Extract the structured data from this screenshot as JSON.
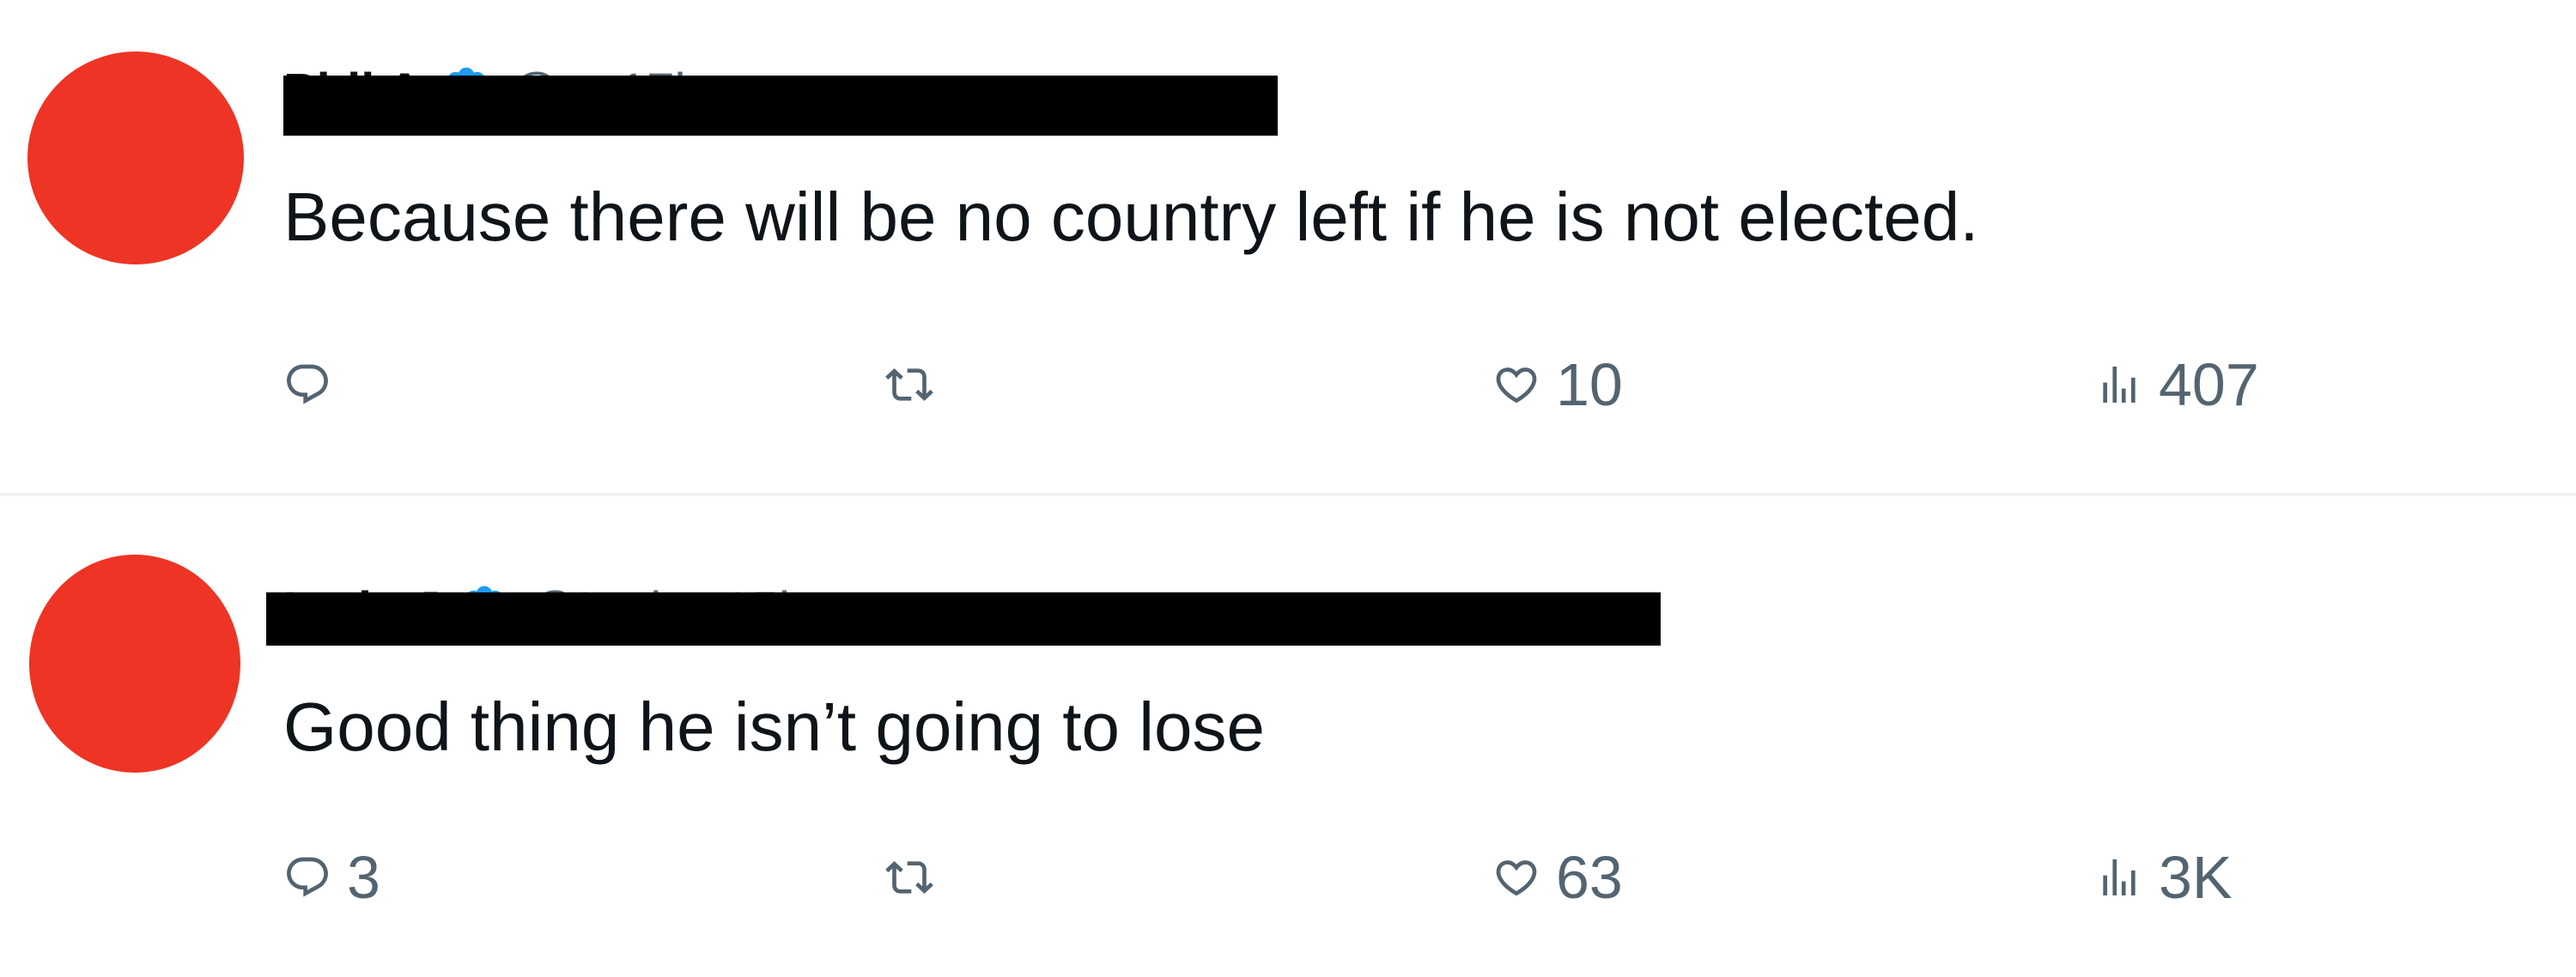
{
  "tweets": [
    {
      "display_name": "Phil A",
      "handle": "@p_",
      "time": "17h",
      "text": "Because there will be no country left if he is not elected.",
      "actions": {
        "replies": "",
        "retweets": "",
        "likes": "10",
        "views": "407"
      }
    },
    {
      "display_name": "Lady J",
      "handle": "@LadyP",
      "time": "15h",
      "text": "Good thing he isn’t going to lose",
      "actions": {
        "replies": "3",
        "retweets": "",
        "likes": "63",
        "views": "3K"
      }
    }
  ],
  "colors": {
    "avatar": "#ee3424",
    "text_primary": "#0f1419",
    "text_secondary": "#536471",
    "verified": "#1d9bf0",
    "divider": "#eff3f4",
    "redaction": "#000000"
  },
  "icons": {
    "reply": "speech-bubble-icon",
    "retweet": "retweet-arrows-icon",
    "like": "heart-icon",
    "views": "bar-chart-icon",
    "verified": "verified-badge-icon"
  }
}
